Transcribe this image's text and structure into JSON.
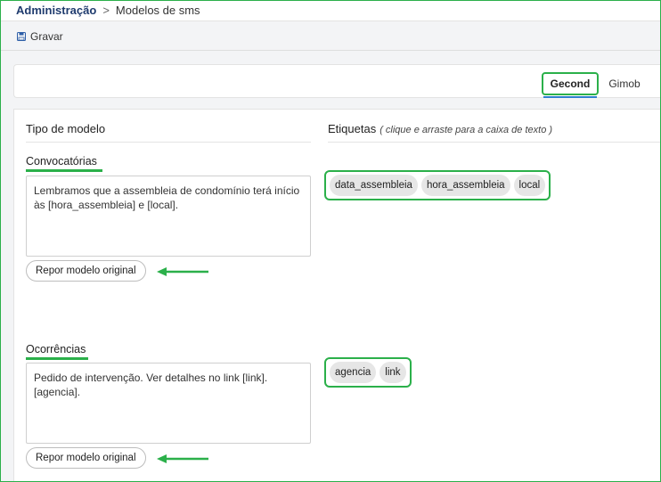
{
  "breadcrumb": {
    "root": "Administração",
    "separator": ">",
    "current": "Modelos de sms"
  },
  "toolbar": {
    "save_label": "Gravar",
    "save_icon": "save-icon"
  },
  "tabs": [
    {
      "label": "Gecond",
      "active": true
    },
    {
      "label": "Gimob",
      "active": false
    }
  ],
  "columns": {
    "left_title": "Tipo de modelo",
    "right_title": "Etiquetas",
    "right_hint": "( clique e arraste para a caixa de texto )"
  },
  "sections": [
    {
      "title": "Convocatórias",
      "text": "Lembramos que a assembleia de condomínio terá início às [hora_assembleia] e [local].",
      "reset_label": "Repor modelo original",
      "tags": [
        "data_assembleia",
        "hora_assembleia",
        "local"
      ]
    },
    {
      "title": "Ocorrências",
      "text": "Pedido de intervenção. Ver detalhes no link [link]. [agencia].",
      "reset_label": "Repor modelo original",
      "tags": [
        "agencia",
        "link"
      ]
    }
  ],
  "colors": {
    "highlight": "#2bb04a",
    "active_tab_underline": "#2e7fcf",
    "breadcrumb_root": "#1f3b6e"
  }
}
